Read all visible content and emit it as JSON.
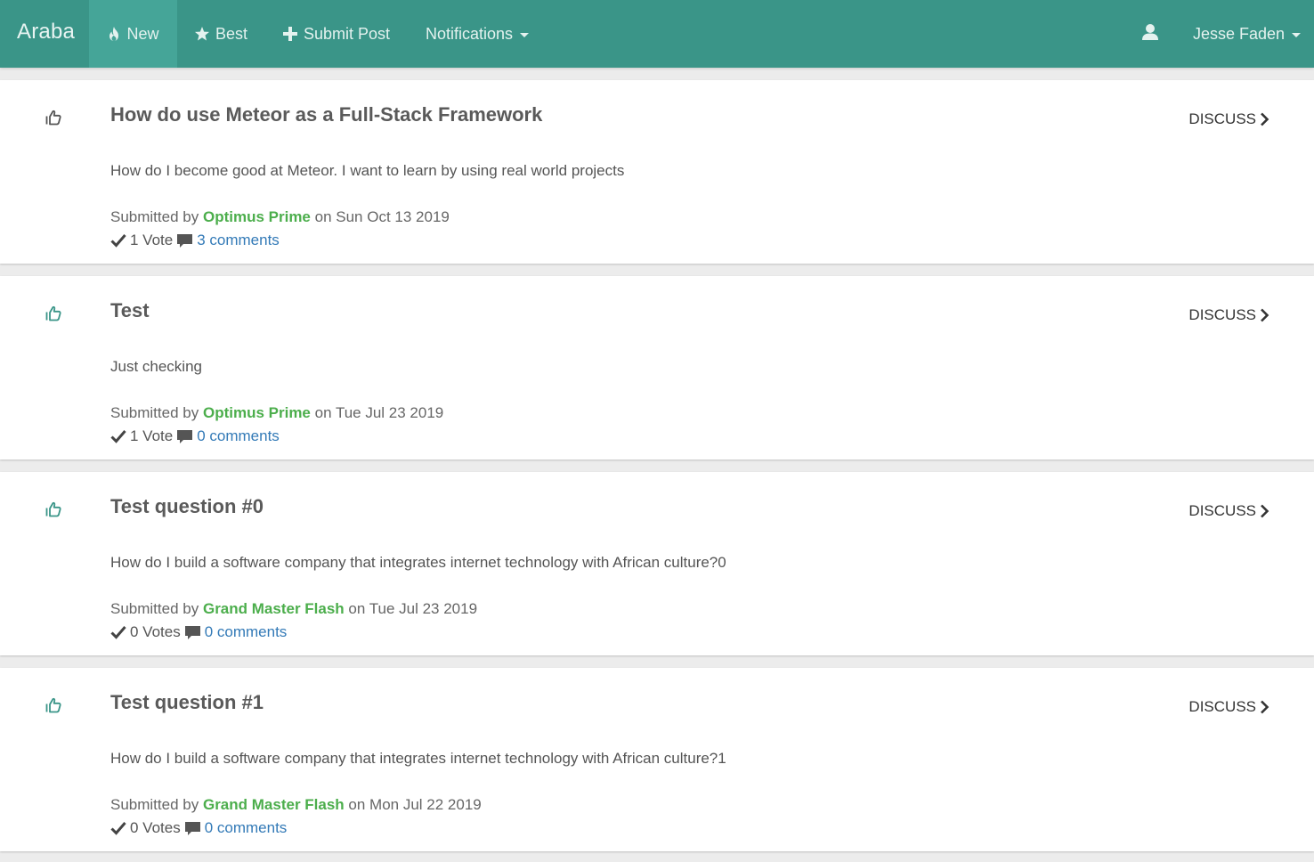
{
  "navbar": {
    "brand": "Araba",
    "items": [
      {
        "label": "New",
        "icon": "fire-icon",
        "active": true
      },
      {
        "label": "Best",
        "icon": "star-icon"
      },
      {
        "label": "Submit Post",
        "icon": "plus-icon"
      },
      {
        "label": "Notifications"
      }
    ],
    "user": {
      "name": "Jesse Faden",
      "icon": "user-icon"
    }
  },
  "posts": [
    {
      "title": "How do use Meteor as a Full-Stack Framework",
      "body": "How do I become good at Meteor. I want to learn by using real world projects",
      "submitted_prefix": "Submitted by",
      "author": "Optimus Prime",
      "date_text": "on Sun Oct 13 2019",
      "votes": "1 Vote",
      "comments": "3 comments",
      "discuss": "DISCUSS",
      "upvoted": false
    },
    {
      "title": "Test",
      "body": "Just checking",
      "submitted_prefix": "Submitted by",
      "author": "Optimus Prime",
      "date_text": "on Tue Jul 23 2019",
      "votes": "1 Vote",
      "comments": "0 comments",
      "discuss": "DISCUSS",
      "upvoted": true
    },
    {
      "title": "Test question #0",
      "body": "How do I build a software company that integrates internet technology with African culture?0",
      "submitted_prefix": "Submitted by",
      "author": "Grand Master Flash",
      "date_text": "on Tue Jul 23 2019",
      "votes": "0 Votes",
      "comments": "0 comments",
      "discuss": "DISCUSS",
      "upvoted": true
    },
    {
      "title": "Test question #1",
      "body": "How do I build a software company that integrates internet technology with African culture?1",
      "submitted_prefix": "Submitted by",
      "author": "Grand Master Flash",
      "date_text": "on Mon Jul 22 2019",
      "votes": "0 Votes",
      "comments": "0 comments",
      "discuss": "DISCUSS",
      "upvoted": true
    }
  ],
  "colors": {
    "navbar": "#3a9588",
    "active_nav": "#45a598",
    "author": "#4cae4c",
    "link": "#337ab7",
    "thumb_active": "#3a9588",
    "thumb_inactive": "#555555"
  }
}
